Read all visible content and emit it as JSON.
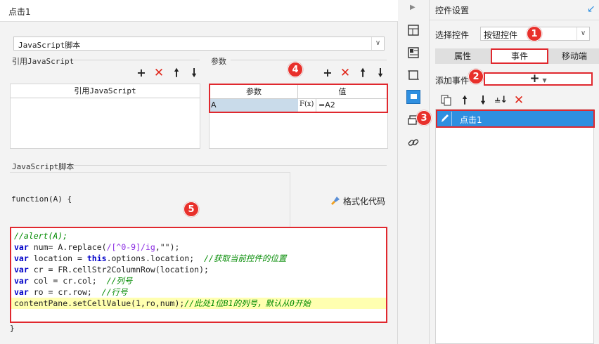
{
  "dialog": {
    "title": "点击1",
    "script_type": "JavaScript脚本",
    "ref_js_label": "引用JavaScript",
    "ref_js_header": "引用JavaScript",
    "params_label": "参数",
    "params_headers": [
      "参数",
      "值"
    ],
    "param_row": {
      "name": "A",
      "fx": "F(x)",
      "value": "=A2"
    },
    "js_script_label": "JavaScript脚本",
    "function_sig": "function(A) {",
    "format_button": "格式化代码",
    "closing_brace": "}",
    "code_lines": [
      {
        "segments": [
          {
            "t": "//alert(A);",
            "c": "cm"
          }
        ]
      },
      {
        "segments": [
          {
            "t": "var",
            "c": "kw"
          },
          {
            "t": " num= A.replace(",
            "c": ""
          },
          {
            "t": "/[^0-9]/ig",
            "c": "str"
          },
          {
            "t": ",\"\");",
            "c": ""
          }
        ]
      },
      {
        "segments": [
          {
            "t": "var",
            "c": "kw"
          },
          {
            "t": " location = ",
            "c": ""
          },
          {
            "t": "this",
            "c": "kw"
          },
          {
            "t": ".options.location;  ",
            "c": ""
          },
          {
            "t": "//获取当前控件的位置",
            "c": "cm"
          }
        ]
      },
      {
        "segments": [
          {
            "t": "var",
            "c": "kw"
          },
          {
            "t": " cr = FR.cellStr2ColumnRow(location);",
            "c": ""
          }
        ]
      },
      {
        "segments": [
          {
            "t": "var",
            "c": "kw"
          },
          {
            "t": " col = cr.col;  ",
            "c": ""
          },
          {
            "t": "//列号",
            "c": "cm"
          }
        ]
      },
      {
        "segments": [
          {
            "t": "var",
            "c": "kw"
          },
          {
            "t": " ro = cr.row;  ",
            "c": ""
          },
          {
            "t": "//行号",
            "c": "cm"
          }
        ]
      },
      {
        "segments": [
          {
            "t": "contentPane.setCellValue(1,ro,num);",
            "c": ""
          },
          {
            "t": "//此处1位B1的列号，默认从0开始",
            "c": "cm"
          }
        ],
        "highlight": true
      }
    ]
  },
  "badges": [
    "1",
    "2",
    "3",
    "4",
    "5"
  ],
  "right_panel": {
    "title": "控件设置",
    "select_label": "选择控件",
    "select_value": "按钮控件",
    "tabs": [
      "属性",
      "事件",
      "移动端"
    ],
    "active_tab": "事件",
    "add_event_label": "添加事件",
    "add_event_icon": "+",
    "event_item": "点击1"
  },
  "colors": {
    "accent_red": "#e0282e",
    "selected_blue": "#2f8fe0",
    "close_red": "#e0261a"
  }
}
